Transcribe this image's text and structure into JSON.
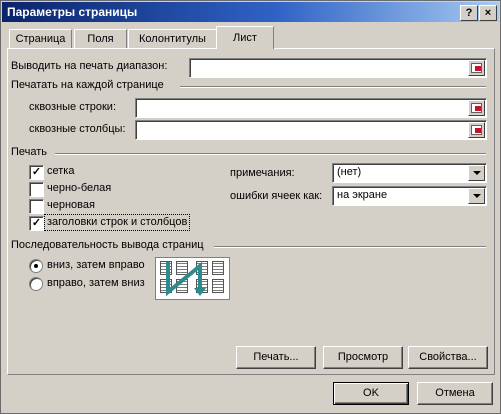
{
  "window": {
    "title": "Параметры страницы",
    "help_label": "?",
    "close_label": "×"
  },
  "tabs": [
    {
      "label": "Страница",
      "active": false
    },
    {
      "label": "Поля",
      "active": false
    },
    {
      "label": "Колонтитулы",
      "active": false
    },
    {
      "label": "Лист",
      "active": true
    }
  ],
  "print_area": {
    "label": "Выводить на печать диапазон:",
    "value": ""
  },
  "print_titles": {
    "group_label": "Печатать на каждой странице",
    "rows_label": "сквозные строки:",
    "rows_value": "",
    "cols_label": "сквозные столбцы:",
    "cols_value": ""
  },
  "print": {
    "group_label": "Печать",
    "checkboxes": [
      {
        "label": "сетка",
        "checked": true
      },
      {
        "label": "черно-белая",
        "checked": false
      },
      {
        "label": "черновая",
        "checked": false
      },
      {
        "label": "заголовки строк и столбцов",
        "checked": true
      }
    ],
    "comments_label": "примечания:",
    "comments_value": "(нет)",
    "errors_label": "ошибки ячеек как:",
    "errors_value": "на экране"
  },
  "page_order": {
    "group_label": "Последовательность вывода страниц",
    "options": [
      {
        "label": "вниз, затем вправо",
        "selected": true
      },
      {
        "label": "вправо, затем вниз",
        "selected": false
      }
    ]
  },
  "buttons": {
    "print": "Печать...",
    "preview": "Просмотр",
    "properties": "Свойства...",
    "ok": "OK",
    "cancel": "Отмена"
  },
  "colors": {
    "dialog_bg": "#d4d0c8",
    "title_start": "#0a246a",
    "title_end": "#a6caf0",
    "preview_arrow": "#2e8b8b"
  }
}
